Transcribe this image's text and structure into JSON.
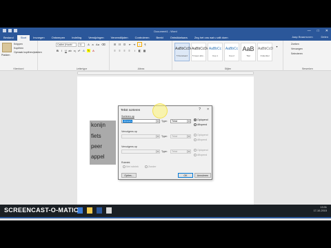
{
  "window": {
    "title": "Document1 - Word"
  },
  "tabs": [
    "Bestand",
    "Start",
    "Invoegen",
    "Ontwerpen",
    "Indeling",
    "Verwijzingen",
    "Verzendlijsten",
    "Controleren",
    "Beeld",
    "Ontwikkelaars"
  ],
  "tab_search": "Zeg het ons wat u wilt doen",
  "user": "Jaap Braamvorm",
  "share": "Delen",
  "clipboard": {
    "paste": "Plakken",
    "cut": "Knippen",
    "copy": "Kopiëren",
    "format_painter": "Opmaak kopiëren/plakken",
    "label": "Klembord"
  },
  "font": {
    "name": "Calibri (Hoofd",
    "size": "11",
    "label": "Lettertype"
  },
  "paragraph": {
    "label": "Alinea"
  },
  "styles": {
    "label": "Stijlen",
    "items": [
      {
        "preview": "AaBbCcDc",
        "name": "¶ Standaard"
      },
      {
        "preview": "AaBbCcDc",
        "name": "¶ Geen afst..."
      },
      {
        "preview": "AaBbCc",
        "name": "Kop 1"
      },
      {
        "preview": "AaBbCc",
        "name": "Kop 2"
      },
      {
        "preview": "AaB",
        "name": "Titel"
      },
      {
        "preview": "AaBbCcD",
        "name": "Ondertitel"
      }
    ]
  },
  "editing": {
    "find": "Zoeken",
    "replace": "Vervangen",
    "select": "Selecteren",
    "label": "Bewerken"
  },
  "document": {
    "words": [
      "konijn",
      "fiets",
      "peer",
      "appel"
    ]
  },
  "dialog": {
    "title": "Tekst sorteren",
    "help": "?",
    "close": "×",
    "sort_by_label": "Sorteren op",
    "sort_by_value": "Alinea's",
    "type_label": "Type:",
    "type_value": "Tekst",
    "ascending": "Oplopend",
    "descending": "Aflopend",
    "then_by_label": "Vervolgens op",
    "then_by2_label": "Vervolgens op",
    "type2_value": "Tekst",
    "type3_value": "Tekst",
    "header_row_label": "Rubriek",
    "with_header": "Met rubriek",
    "no_header": "Zonder",
    "options": "Opties...",
    "ok": "OK",
    "cancel": "Annuleren"
  },
  "statusbar": {
    "page": "Pagina 1 van 1",
    "words": "4 van 4 woorden",
    "lang": "Nederlands (Nederland)"
  },
  "clock": {
    "time": "13:31",
    "date": "17-10-2015"
  },
  "brand": "SCREENCAST-O-MATIC"
}
